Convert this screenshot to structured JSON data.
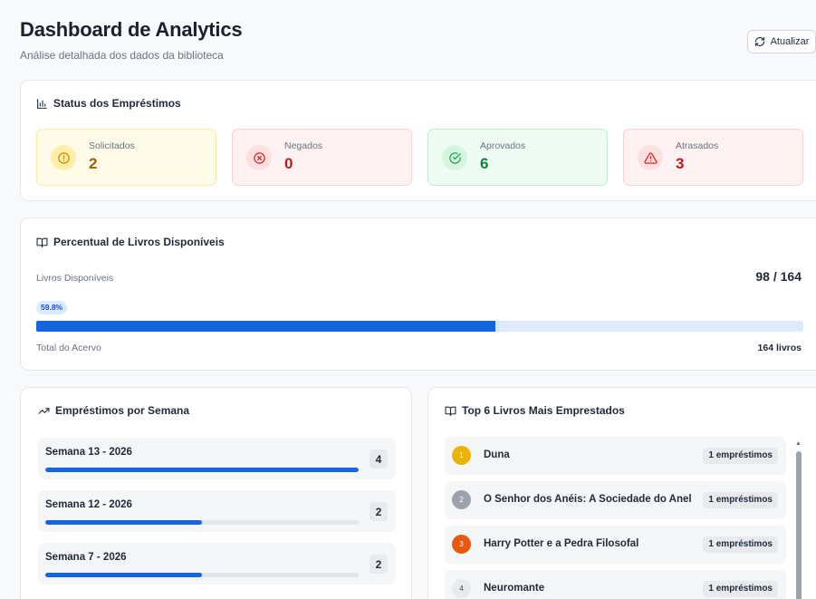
{
  "header": {
    "title": "Dashboard de Analytics",
    "subtitle": "Análise detalhada dos dados da biblioteca",
    "refresh_label": "Atualizar"
  },
  "status": {
    "title": "Status dos Empréstimos",
    "items": [
      {
        "label": "Solicitados",
        "value": "2",
        "icon": "alert-circle-icon"
      },
      {
        "label": "Negados",
        "value": "0",
        "icon": "x-circle-icon"
      },
      {
        "label": "Aprovados",
        "value": "6",
        "icon": "check-circle-icon"
      },
      {
        "label": "Atrasados",
        "value": "3",
        "icon": "warning-triangle-icon"
      }
    ]
  },
  "availability": {
    "title": "Percentual de Livros Disponíveis",
    "label": "Livros Disponíveis",
    "count": "98 / 164",
    "percent_label": "59.8%",
    "percent": 59.8,
    "total_label": "Total do Acervo",
    "total_value": "164 livros"
  },
  "weekly": {
    "title": "Empréstimos por Semana",
    "rows": [
      {
        "label": "Semana 13 - 2026",
        "count": "4",
        "fraction": 1.0
      },
      {
        "label": "Semana 12 - 2026",
        "count": "2",
        "fraction": 0.5
      },
      {
        "label": "Semana 7 - 2026",
        "count": "2",
        "fraction": 0.5
      }
    ]
  },
  "top_books": {
    "title": "Top 6 Livros Mais Emprestados",
    "rows": [
      {
        "rank": "1",
        "title": "Duna",
        "badge": "1 empréstimos"
      },
      {
        "rank": "2",
        "title": "O Senhor dos Anéis: A Sociedade do Anel",
        "badge": "1 empréstimos"
      },
      {
        "rank": "3",
        "title": "Harry Potter e a Pedra Filosofal",
        "badge": "1 empréstimos"
      },
      {
        "rank": "4",
        "title": "Neuromante",
        "badge": "1 empréstimos"
      }
    ]
  },
  "colors": {
    "accent": "#1565e0",
    "yellow": "#a16207",
    "red": "#b91c1c",
    "green": "#15803d"
  }
}
